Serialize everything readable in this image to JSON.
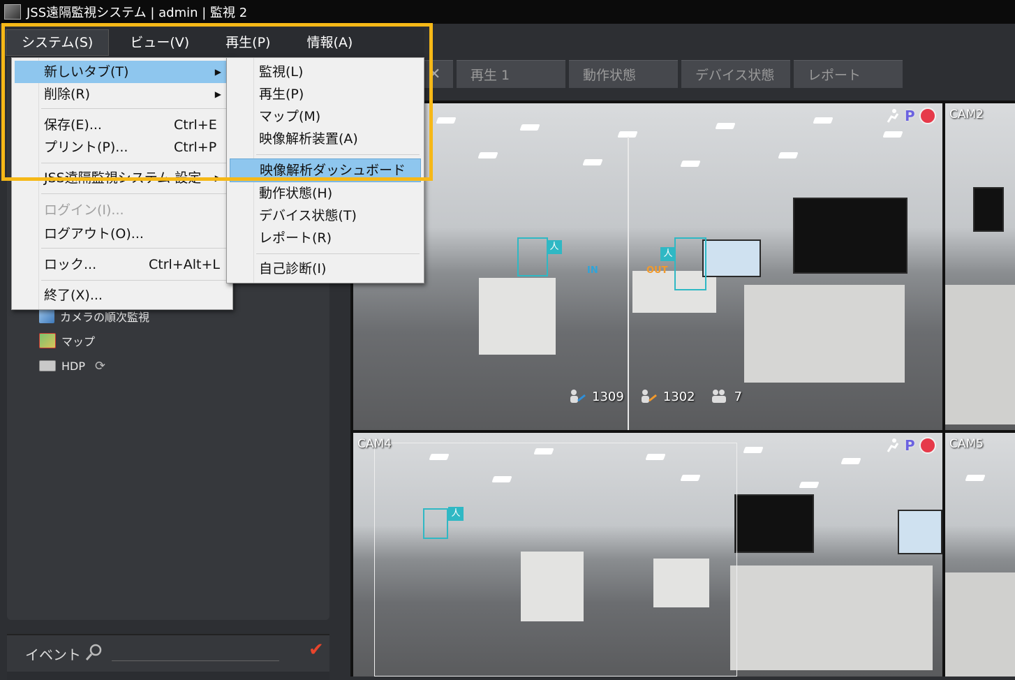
{
  "window": {
    "title": "JSS遠隔監視システム | admin | 監視 2"
  },
  "menubar": {
    "items": [
      {
        "label": "システム(S)",
        "active": true
      },
      {
        "label": "ビュー(V)"
      },
      {
        "label": "再生(P)"
      },
      {
        "label": "情報(A)"
      }
    ]
  },
  "system_menu": {
    "items": [
      {
        "label": "新しいタブ(T)",
        "shortcut": "",
        "submenu": true,
        "highlighted": true
      },
      {
        "label": "削除(R)",
        "shortcut": "",
        "submenu": true
      },
      {
        "label": "保存(E)...",
        "shortcut": "Ctrl+E"
      },
      {
        "label": "プリント(P)...",
        "shortcut": "Ctrl+P"
      },
      {
        "label": "JSS遠隔監視システム 設定",
        "shortcut": "",
        "submenu": true
      },
      {
        "label": "ログイン(I)...",
        "shortcut": "",
        "disabled": true
      },
      {
        "label": "ログアウト(O)...",
        "shortcut": ""
      },
      {
        "label": "ロック...",
        "shortcut": "Ctrl+Alt+L"
      },
      {
        "label": "終了(X)...",
        "shortcut": ""
      }
    ]
  },
  "new_tab_submenu": {
    "items": [
      {
        "label": "監視(L)"
      },
      {
        "label": "再生(P)"
      },
      {
        "label": "マップ(M)"
      },
      {
        "label": "映像解析装置(A)"
      },
      {
        "label": "映像解析ダッシュボード",
        "highlighted": true
      },
      {
        "label": "動作状態(H)"
      },
      {
        "label": "デバイス状態(T)"
      },
      {
        "label": "レポート(R)"
      },
      {
        "label": "自己診断(I)"
      }
    ]
  },
  "tabs": [
    {
      "label": "再生 1"
    },
    {
      "label": "動作状態"
    },
    {
      "label": "デバイス状態"
    },
    {
      "label": "レポート"
    }
  ],
  "left_tree": {
    "items": [
      {
        "label": "カメラの順次監視",
        "icon": "camera-sequence-icon"
      },
      {
        "label": "マップ",
        "icon": "map-icon"
      },
      {
        "label": "HDP",
        "icon": "hdp-device-icon"
      }
    ]
  },
  "event_panel": {
    "label": "イベント"
  },
  "cameras": [
    {
      "label": "CAM2"
    },
    {
      "label": "CAM4"
    },
    {
      "label": "CAM5"
    }
  ],
  "counters": {
    "in": "1309",
    "out": "1302",
    "occupancy": "7"
  },
  "detection": {
    "tag": "人",
    "in_text": "IN",
    "out_text": "OUT"
  },
  "colors": {
    "accent_highlight": "#f6b817",
    "menu_selected": "#8ec6ee",
    "record": "#e63a4a"
  }
}
